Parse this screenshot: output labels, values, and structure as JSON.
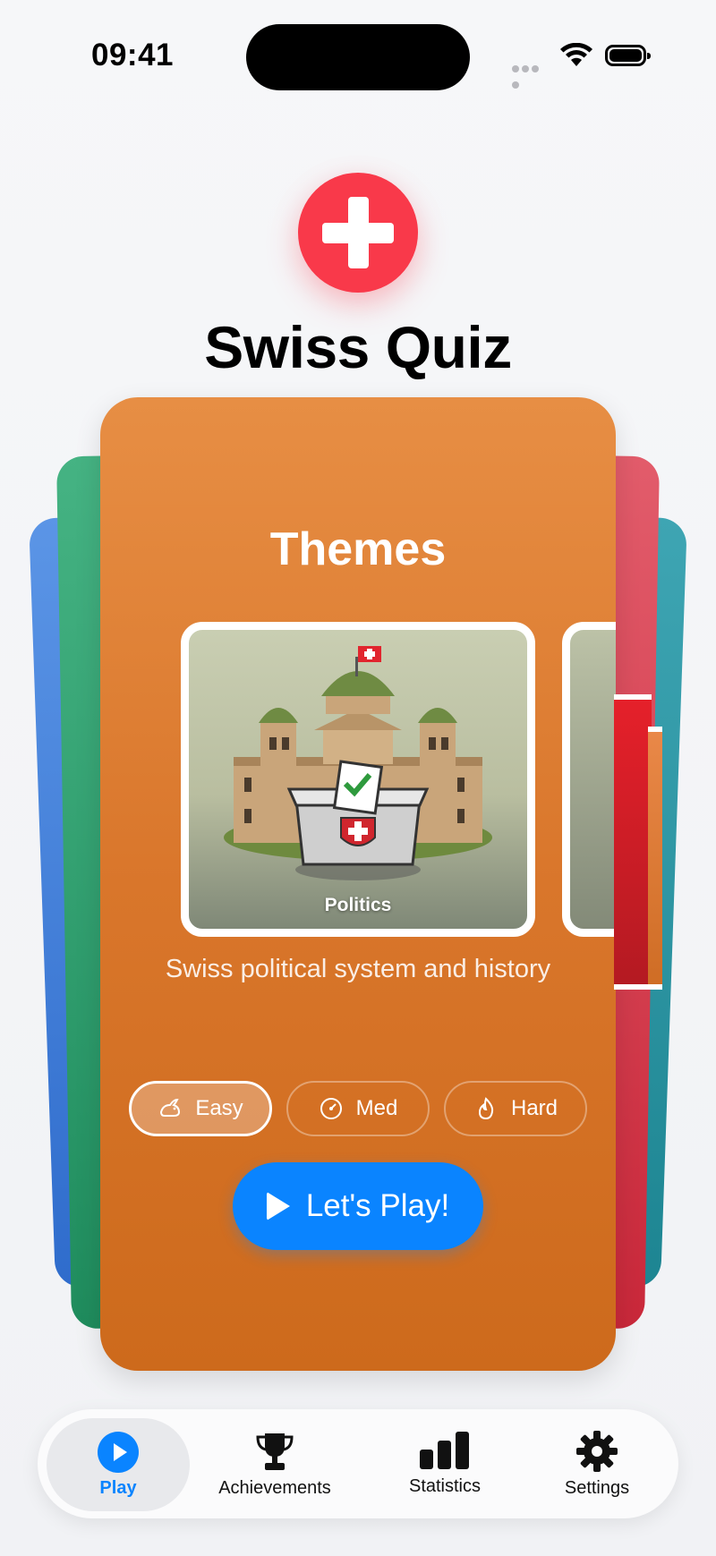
{
  "status_bar": {
    "time": "09:41"
  },
  "app": {
    "title": "Swiss Quiz",
    "logo_icon": "swiss-cross-icon",
    "logo_color": "#f9394a"
  },
  "card": {
    "section_title": "Themes",
    "theme": {
      "label": "Politics",
      "description": "Swiss political system and history",
      "icon": "parliament-ballot-box-illustration"
    },
    "difficulty": [
      {
        "label": "Easy",
        "icon": "rabbit-icon",
        "selected": true
      },
      {
        "label": "Med",
        "icon": "gauge-icon",
        "selected": false
      },
      {
        "label": "Hard",
        "icon": "flame-icon",
        "selected": false
      }
    ],
    "play_button": "Let's Play!",
    "color": "#d9762b"
  },
  "tab_bar": {
    "tabs": [
      {
        "label": "Play",
        "icon": "play-icon",
        "active": true
      },
      {
        "label": "Achievements",
        "icon": "trophy-icon",
        "active": false
      },
      {
        "label": "Statistics",
        "icon": "bar-chart-icon",
        "active": false
      },
      {
        "label": "Settings",
        "icon": "gear-icon",
        "active": false
      }
    ],
    "accent": "#0a84ff"
  }
}
